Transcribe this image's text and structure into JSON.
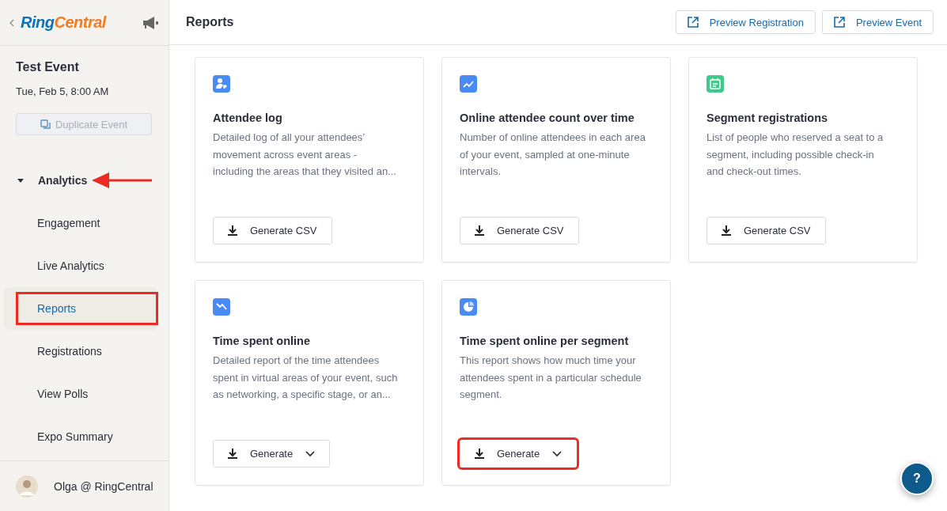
{
  "sidebar": {
    "logo": [
      "Ring",
      "Central"
    ],
    "event_title": "Test Event",
    "event_date": "Tue, Feb 5, 8:00 AM",
    "duplicate_button": {
      "label": "Duplicate Event",
      "disabled": true
    },
    "nav": {
      "label": "Analytics",
      "expanded": true,
      "annotated": true,
      "children": [
        {
          "label": "Engagement",
          "selected": false,
          "annotated": false
        },
        {
          "label": "Live Analytics",
          "selected": false,
          "annotated": false
        },
        {
          "label": "Reports",
          "selected": true,
          "annotated": true
        },
        {
          "label": "Registrations",
          "selected": false,
          "annotated": false
        },
        {
          "label": "View Polls",
          "selected": false,
          "annotated": false
        },
        {
          "label": "Expo Summary",
          "selected": false,
          "annotated": false
        }
      ]
    },
    "user": "Olga @ RingCentral"
  },
  "header": {
    "title": "Reports",
    "buttons": [
      "Preview Registration",
      "Preview Event"
    ]
  },
  "cards": [
    {
      "kind": "person",
      "color": "#4a8af4",
      "title": "Attendee log",
      "description": "Detailed log of all your attendees’ movement across event areas - including the areas that they visited an...",
      "button": {
        "label": "Generate CSV",
        "dropdown": false,
        "annotated": false
      }
    },
    {
      "kind": "trend-up",
      "color": "#4a8af4",
      "title": "Online attendee count over time",
      "description": "Number of online attendees in each area of your event, sampled at one-minute intervals.",
      "button": {
        "label": "Generate CSV",
        "dropdown": false,
        "annotated": false
      }
    },
    {
      "kind": "calendar",
      "color": "#3fc98a",
      "title": "Segment registrations",
      "description": "List of people who reserved a seat to a segment, including possible check-in and check-out times.",
      "button": {
        "label": "Generate CSV",
        "dropdown": false,
        "annotated": false
      }
    },
    {
      "kind": "trend-down",
      "color": "#4a8af4",
      "title": "Time spent online",
      "description": "Detailed report of the time attendees spent in virtual areas of your event, such as networking, a specific stage, or an...",
      "button": {
        "label": "Generate",
        "dropdown": true,
        "annotated": false
      }
    },
    {
      "kind": "pie",
      "color": "#4a8af4",
      "title": "Time spent online per segment",
      "description": "This report shows how much time your attendees spent in a particular schedule segment.",
      "button": {
        "label": "Generate",
        "dropdown": true,
        "annotated": true
      }
    }
  ],
  "help_button": "?"
}
